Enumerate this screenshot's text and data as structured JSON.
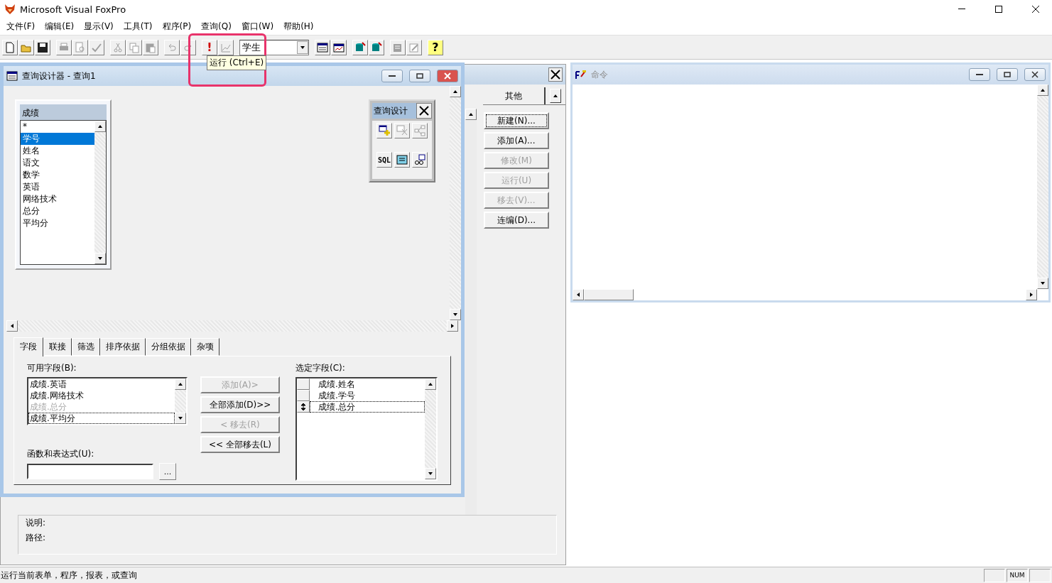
{
  "app": {
    "title": "Microsoft Visual FoxPro"
  },
  "menu": [
    "文件(F)",
    "编辑(E)",
    "显示(V)",
    "工具(T)",
    "程序(P)",
    "查询(Q)",
    "窗口(W)",
    "帮助(H)"
  ],
  "toolbar": {
    "groups": [
      [
        {
          "kind": "new",
          "disabled": false
        },
        {
          "kind": "open",
          "disabled": false
        },
        {
          "kind": "save",
          "disabled": false
        }
      ],
      [
        {
          "kind": "print",
          "disabled": true
        },
        {
          "kind": "preview",
          "disabled": true
        },
        {
          "kind": "spell",
          "disabled": true
        }
      ],
      [
        {
          "kind": "cut",
          "disabled": true
        },
        {
          "kind": "copy",
          "disabled": true
        },
        {
          "kind": "paste",
          "disabled": true
        }
      ],
      [
        {
          "kind": "undo",
          "disabled": true
        },
        {
          "kind": "redo",
          "disabled": true
        }
      ],
      [
        {
          "kind": "run",
          "label": "!",
          "disabled": false
        },
        {
          "kind": "modify",
          "disabled": true
        }
      ],
      [
        {
          "kind": "combo",
          "value": "学生"
        }
      ],
      [
        {
          "kind": "form",
          "disabled": false
        },
        {
          "kind": "report",
          "disabled": false
        }
      ],
      [
        {
          "kind": "database",
          "disabled": false
        },
        {
          "kind": "database",
          "disabled": false
        }
      ],
      [
        {
          "kind": "builder",
          "disabled": true
        },
        {
          "kind": "wizard",
          "disabled": true
        }
      ],
      [
        {
          "kind": "help",
          "label": "?",
          "disabled": false
        }
      ]
    ],
    "tooltip": "运行 (Ctrl+E)"
  },
  "query_designer": {
    "title": "查询设计器 - 查询1",
    "table": {
      "name": "成绩",
      "fields": [
        {
          "label": "*",
          "selected": false
        },
        {
          "label": "学号",
          "selected": true
        },
        {
          "label": "姓名",
          "selected": false
        },
        {
          "label": "语文",
          "selected": false
        },
        {
          "label": "数学",
          "selected": false
        },
        {
          "label": "英语",
          "selected": false
        },
        {
          "label": "网络技术",
          "selected": false
        },
        {
          "label": "总分",
          "selected": false
        },
        {
          "label": "平均分",
          "selected": false
        }
      ]
    },
    "panel": {
      "title": "查询设计",
      "buttons": [
        {
          "kind": "add-table",
          "disabled": false
        },
        {
          "kind": "remove-table",
          "disabled": true
        },
        {
          "kind": "join",
          "disabled": true
        },
        {
          "kind": "sql",
          "label": "SQL",
          "disabled": false
        },
        {
          "kind": "output",
          "disabled": false
        },
        {
          "kind": "view",
          "disabled": false
        }
      ]
    },
    "tabs": [
      {
        "label": "字段",
        "selected": true
      },
      {
        "label": "联接",
        "selected": false
      },
      {
        "label": "筛选",
        "selected": false
      },
      {
        "label": "排序依据",
        "selected": false
      },
      {
        "label": "分组依据",
        "selected": false
      },
      {
        "label": "杂项",
        "selected": false
      }
    ],
    "available_label": "可用字段(B):",
    "available_fields": [
      {
        "label": "成绩.英语",
        "selected": false,
        "disabled": false
      },
      {
        "label": "成绩.网络技术",
        "selected": false,
        "disabled": false
      },
      {
        "label": "成绩.总分",
        "selected": false,
        "disabled": true
      },
      {
        "label": "成绩.平均分",
        "selected": true,
        "disabled": false
      }
    ],
    "move_buttons": [
      {
        "label": "添加(A)>",
        "disabled": true
      },
      {
        "label": "全部添加(D)>>",
        "disabled": false
      },
      {
        "label": "< 移去(R)",
        "disabled": true
      },
      {
        "label": "<< 全部移去(L)",
        "disabled": false
      }
    ],
    "expression_label": "函数和表达式(U):",
    "browse_button": "...",
    "selected_label": "选定字段(C):",
    "selected_fields": [
      {
        "label": "成绩.姓名",
        "selected": false
      },
      {
        "label": "成绩.学号",
        "selected": false
      },
      {
        "label": "成绩.总分",
        "selected": true
      }
    ]
  },
  "project_manager": {
    "tab": "其他",
    "buttons": [
      {
        "label": "新建(N)...",
        "disabled": false,
        "focused": true
      },
      {
        "label": "添加(A)...",
        "disabled": false,
        "focused": false
      },
      {
        "label": "修改(M)",
        "disabled": true,
        "focused": false
      },
      {
        "label": "运行(U)",
        "disabled": true,
        "focused": false
      },
      {
        "label": "移去(V)...",
        "disabled": true,
        "focused": false
      },
      {
        "label": "连编(D)...",
        "disabled": false,
        "focused": false
      }
    ],
    "description_label": "说明:",
    "path_label": "路径:"
  },
  "command_window": {
    "title": "命令"
  },
  "status_bar": {
    "message": "运行当前表单，程序，报表，或查询",
    "indicators": [
      {
        "label": "NUM"
      }
    ]
  }
}
